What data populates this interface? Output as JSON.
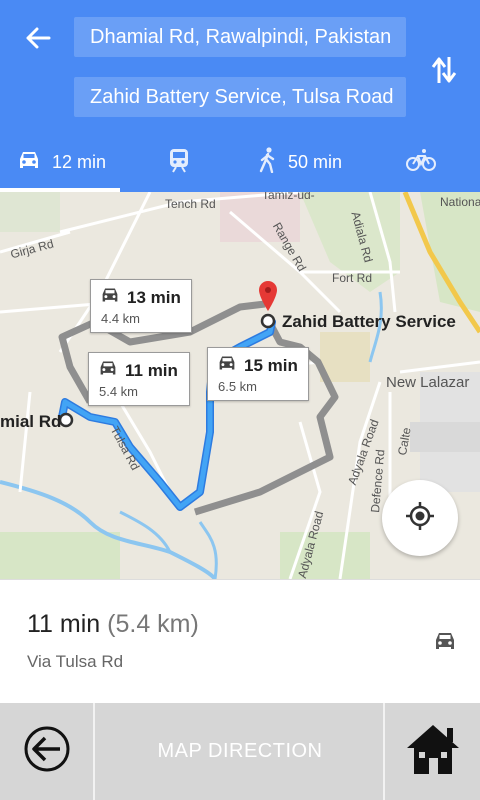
{
  "header": {
    "origin": "Dhamial Rd, Rawalpindi, Pakistan",
    "destination": "Zahid Battery Service, Tulsa Road",
    "modes": [
      {
        "icon": "car-icon",
        "label": "12 min",
        "active": true
      },
      {
        "icon": "train-icon",
        "label": "",
        "active": false
      },
      {
        "icon": "walk-icon",
        "label": "50 min",
        "active": false
      },
      {
        "icon": "bike-icon",
        "label": "",
        "active": false
      }
    ]
  },
  "map": {
    "labels": {
      "tench": "Tench Rd",
      "tamiz": "Tamiz-ud-",
      "adiala": "Adiala Rd",
      "national": "National",
      "girja": "Girja Rd",
      "range": "Range Rd",
      "fort": "Fort Rd",
      "newlalazar": "New Lalazar",
      "tulsa": "Tulsa Rd",
      "adyala": "Adyala Road",
      "defence": "Defence Rd",
      "calte": "Calte",
      "adyala2": "Adyala Road"
    },
    "origin_label": "mial Rd",
    "destination_label": "Zahid Battery Service",
    "routes": [
      {
        "time": "13 min",
        "distance": "4.4 km"
      },
      {
        "time": "11 min",
        "distance": "5.4 km"
      },
      {
        "time": "15 min",
        "distance": "6.5 km"
      }
    ]
  },
  "summary": {
    "time": "11 min",
    "distance": "(5.4 km)",
    "via": "Via Tulsa Rd"
  },
  "bottom": {
    "title": "MAP DIRECTION"
  },
  "colors": {
    "header_bg": "#4a8af4",
    "route_selected": "#3d9cf2",
    "route_alt": "#8f8f8f",
    "pin": "#e53935"
  }
}
